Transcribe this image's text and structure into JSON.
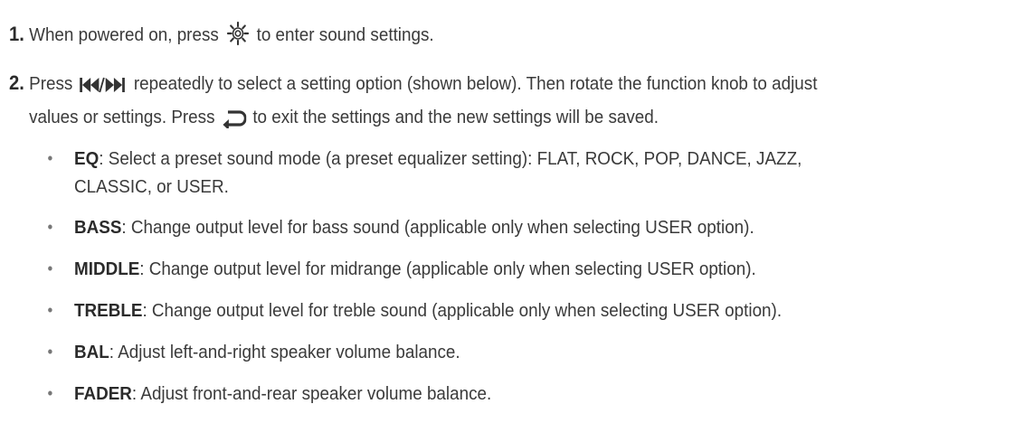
{
  "steps": [
    {
      "number": "1.",
      "text_before_icon": "When powered on, press",
      "icon": "gear-icon",
      "text_after_icon": "to enter sound settings."
    },
    {
      "number": "2.",
      "text_before_icon": "Press",
      "icon": "skip-back-forward-icon",
      "text_after_icon": "repeatedly to select a setting option (shown below). Then rotate the function knob to adjust",
      "line2_before_icon": "values or settings. Press",
      "line2_icon": "return-arrow-icon",
      "line2_after_icon": "to exit the settings and the new settings will be saved."
    }
  ],
  "options": [
    {
      "term": "EQ",
      "desc_line1": ": Select a preset sound mode (a preset equalizer setting): FLAT, ROCK, POP, DANCE, JAZZ,",
      "desc_line2": "CLASSIC, or USER."
    },
    {
      "term": "BASS",
      "desc_line1": ": Change output level for bass sound (applicable only when selecting USER option)."
    },
    {
      "term": "MIDDLE",
      "desc_line1": ": Change output level for midrange (applicable only when selecting USER option)."
    },
    {
      "term": "TREBLE",
      "desc_line1": ": Change output level for treble sound (applicable only when selecting USER option)."
    },
    {
      "term": "BAL",
      "desc_line1": ": Adjust left-and-right speaker volume balance."
    },
    {
      "term": "FADER",
      "desc_line1": ": Adjust front-and-rear speaker volume balance."
    }
  ]
}
